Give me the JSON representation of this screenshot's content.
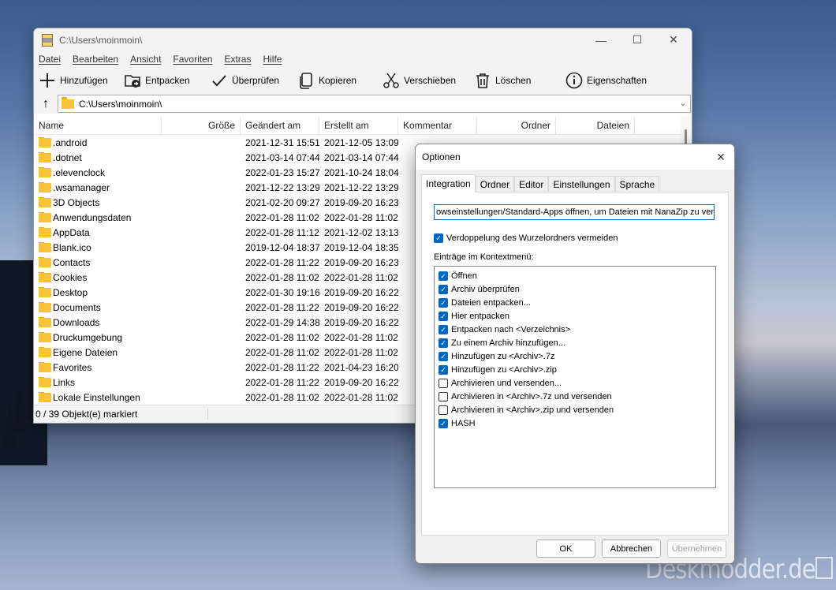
{
  "window": {
    "title": "C:\\Users\\moinmoin\\",
    "minimize": "—",
    "maximize": "☐",
    "close": "✕"
  },
  "menu": [
    "Datei",
    "Bearbeiten",
    "Ansicht",
    "Favoriten",
    "Extras",
    "Hilfe"
  ],
  "toolbar": [
    {
      "label": "Hinzufügen",
      "icon": "plus-icon"
    },
    {
      "label": "Entpacken",
      "icon": "extract-folder-icon"
    },
    {
      "label": "Überprüfen",
      "icon": "checkmark-icon"
    },
    {
      "label": "Kopieren",
      "icon": "copy-icon"
    },
    {
      "label": "Verschieben",
      "icon": "scissors-icon"
    },
    {
      "label": "Löschen",
      "icon": "trash-icon"
    },
    {
      "label": "Eigenschaften",
      "icon": "info-icon"
    }
  ],
  "path": "C:\\Users\\moinmoin\\",
  "columns": [
    "Name",
    "Größe",
    "Geändert am",
    "Erstellt am",
    "Kommentar",
    "Ordner",
    "Dateien"
  ],
  "rows": [
    {
      "name": ".android",
      "modified": "2021-12-31 15:51",
      "created": "2021-12-05 13:09"
    },
    {
      "name": ".dotnet",
      "modified": "2021-03-14 07:44",
      "created": "2021-03-14 07:44"
    },
    {
      "name": ".elevenclock",
      "modified": "2022-01-23 15:27",
      "created": "2021-10-24 18:04"
    },
    {
      "name": ".wsamanager",
      "modified": "2021-12-22 13:29",
      "created": "2021-12-22 13:29"
    },
    {
      "name": "3D Objects",
      "modified": "2021-02-20 09:27",
      "created": "2019-09-20 16:23"
    },
    {
      "name": "Anwendungsdaten",
      "modified": "2022-01-28 11:02",
      "created": "2022-01-28 11:02"
    },
    {
      "name": "AppData",
      "modified": "2022-01-28 11:12",
      "created": "2021-12-02 13:13"
    },
    {
      "name": "Blank.ico",
      "modified": "2019-12-04 18:37",
      "created": "2019-12-04 18:35"
    },
    {
      "name": "Contacts",
      "modified": "2022-01-28 11:22",
      "created": "2019-09-20 16:23"
    },
    {
      "name": "Cookies",
      "modified": "2022-01-28 11:02",
      "created": "2022-01-28 11:02"
    },
    {
      "name": "Desktop",
      "modified": "2022-01-30 19:16",
      "created": "2019-09-20 16:22"
    },
    {
      "name": "Documents",
      "modified": "2022-01-28 11:22",
      "created": "2019-09-20 16:22"
    },
    {
      "name": "Downloads",
      "modified": "2022-01-29 14:38",
      "created": "2019-09-20 16:22"
    },
    {
      "name": "Druckumgebung",
      "modified": "2022-01-28 11:02",
      "created": "2022-01-28 11:02"
    },
    {
      "name": "Eigene Dateien",
      "modified": "2022-01-28 11:02",
      "created": "2022-01-28 11:02"
    },
    {
      "name": "Favorites",
      "modified": "2022-01-28 11:22",
      "created": "2021-04-23 16:20"
    },
    {
      "name": "Links",
      "modified": "2022-01-28 11:22",
      "created": "2019-09-20 16:22"
    },
    {
      "name": "Lokale Einstellungen",
      "modified": "2022-01-28 11:02",
      "created": "2022-01-28 11:02"
    }
  ],
  "status": "0 / 39 Objekt(e) markiert",
  "dialog": {
    "title": "Optionen",
    "close": "✕",
    "tabs": [
      "Integration",
      "Ordner",
      "Editor",
      "Einstellungen",
      "Sprache"
    ],
    "assoc_button": "owseinstellungen/Standard-Apps öffnen, um Dateien mit NanaZip zu verknü",
    "duplicate_label": "Verdoppelung des Wurzelordners vermeiden",
    "duplicate_checked": true,
    "context_label": "Einträge im Kontextmenü:",
    "context_items": [
      {
        "label": "Öffnen",
        "checked": true
      },
      {
        "label": "Archiv überprüfen",
        "checked": true
      },
      {
        "label": "Dateien entpacken...",
        "checked": true
      },
      {
        "label": "Hier entpacken",
        "checked": true
      },
      {
        "label": "Entpacken nach <Verzeichnis>",
        "checked": true
      },
      {
        "label": "Zu einem Archiv hinzufügen...",
        "checked": true
      },
      {
        "label": "Hinzufügen zu <Archiv>.7z",
        "checked": true
      },
      {
        "label": "Hinzufügen zu <Archiv>.zip",
        "checked": true
      },
      {
        "label": "Archivieren und versenden...",
        "checked": false
      },
      {
        "label": "Archivieren in <Archiv>.7z und versenden",
        "checked": false
      },
      {
        "label": "Archivieren in <Archiv>.zip und versenden",
        "checked": false
      },
      {
        "label": "HASH",
        "checked": true
      }
    ],
    "ok": "OK",
    "cancel": "Abbrechen",
    "apply": "Übernehmen"
  },
  "watermark": "Deskmodder.de"
}
